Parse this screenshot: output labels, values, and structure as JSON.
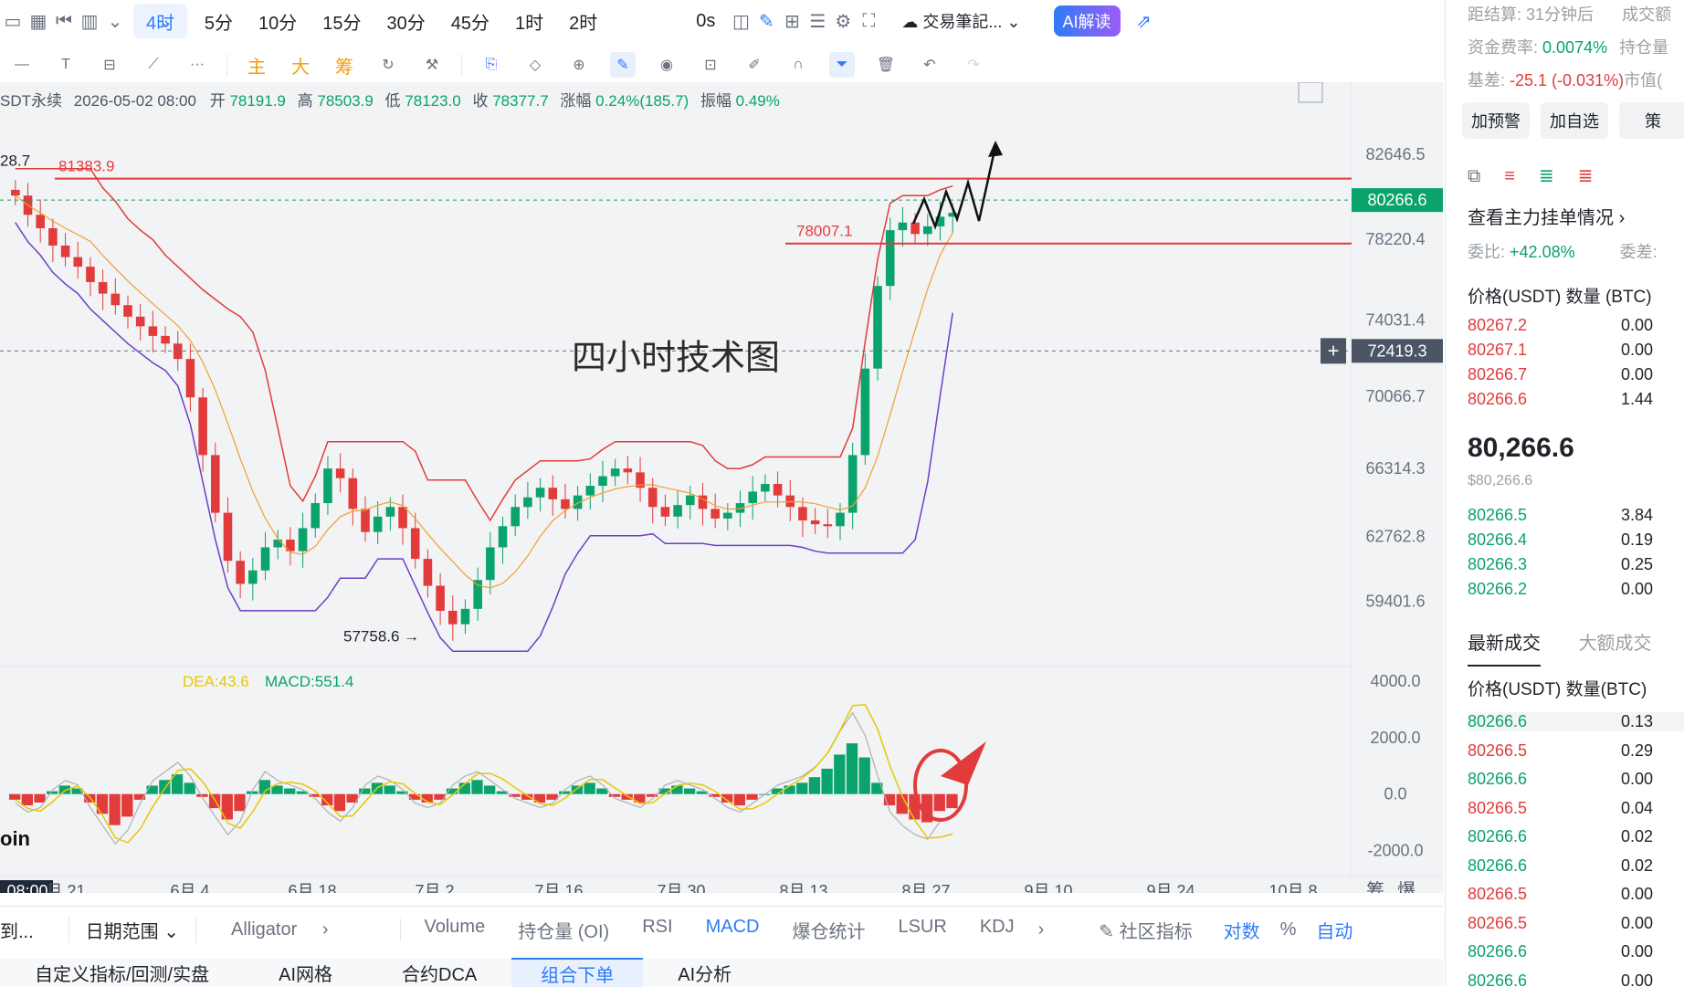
{
  "toolbar": {
    "timeframes": [
      "4时",
      "5分",
      "10分",
      "15分",
      "30分",
      "45分",
      "1时",
      "2时"
    ],
    "active_timeframe": "4时",
    "realtime_label": "0s",
    "journal_label": "交易筆記...",
    "ai_label": "AI解读"
  },
  "drawing_tools": {
    "indicator_labels": [
      "主",
      "大",
      "筹"
    ]
  },
  "ohlc": {
    "symbol": "SDT永续",
    "datetime": "2026-05-02 08:00",
    "open_label": "开",
    "open": "78191.9",
    "high_label": "高",
    "high": "78503.9",
    "low_label": "低",
    "low": "78123.0",
    "close_label": "收",
    "close": "78377.7",
    "change_label": "涨幅",
    "change": "0.24%(185.7)",
    "amplitude_label": "振幅",
    "amplitude": "0.49%"
  },
  "chart_data": {
    "type": "candlestick",
    "annotation_title": "四小时技术图",
    "price_axis_ticks": [
      "82646.5",
      "78220.4",
      "74031.4",
      "70066.7",
      "66314.3",
      "62762.8",
      "59401.6"
    ],
    "current_price_tag": "80266.6",
    "crosshair_price_tag": "72419.3",
    "hline_labels": [
      "81383.9",
      "78007.1"
    ],
    "high_marker": "28.7",
    "low_marker": "57758.6 →",
    "time_axis_ticks": [
      "08:00",
      "月 21",
      "6月 4",
      "6月 18",
      "7月 2",
      "7月 16",
      "7月 30",
      "8月 13",
      "8月 27",
      "9月 10",
      "9月 24",
      "10月 8"
    ],
    "close_series": [
      80500,
      79500,
      78800,
      77900,
      77300,
      76800,
      76000,
      75400,
      74800,
      74200,
      73700,
      73200,
      72800,
      72000,
      70000,
      67000,
      64000,
      61500,
      60300,
      61000,
      62200,
      62600,
      62000,
      63200,
      64500,
      66300,
      65800,
      64200,
      63000,
      63800,
      64300,
      63200,
      61600,
      60200,
      58900,
      58200,
      59000,
      60500,
      62200,
      63300,
      64300,
      64800,
      65300,
      64700,
      64200,
      64900,
      65400,
      65900,
      66300,
      66100,
      65300,
      64300,
      63800,
      64400,
      64900,
      64200,
      63700,
      64000,
      64500,
      65100,
      65500,
      64900,
      64300,
      63600,
      63400,
      63300,
      64000,
      67000,
      71500,
      75800,
      78700,
      79100,
      78500,
      78900,
      79400,
      79600
    ],
    "macd": {
      "dea_label": "DEA:43.6",
      "macd_label": "MACD:551.4",
      "axis_ticks": [
        "4000.0",
        "2000.0",
        "0.0",
        "-2000.0"
      ],
      "histogram": [
        -200,
        -400,
        -300,
        100,
        300,
        200,
        -300,
        -700,
        -1100,
        -800,
        -200,
        300,
        500,
        700,
        400,
        -100,
        -500,
        -900,
        -600,
        100,
        500,
        300,
        200,
        100,
        -100,
        -400,
        -600,
        -300,
        200,
        400,
        300,
        100,
        -200,
        -300,
        -200,
        200,
        400,
        500,
        300,
        100,
        -100,
        -200,
        -300,
        -200,
        100,
        300,
        400,
        200,
        -100,
        -200,
        -300,
        -100,
        200,
        300,
        200,
        100,
        -100,
        -300,
        -400,
        -200,
        0,
        200,
        300,
        400,
        600,
        900,
        1400,
        1800,
        1300,
        400,
        -400,
        -700,
        -900,
        -1000,
        -600,
        -500
      ]
    }
  },
  "chart_controls": {
    "chip_label": "筹",
    "burst_label": "爆",
    "coin_label": "oin"
  },
  "indicator_bar": {
    "left_labels": [
      "到...",
      "日期范围",
      "Alligator"
    ],
    "tabs": [
      "Volume",
      "持仓量 (OI)",
      "RSI",
      "MACD",
      "爆仓统计",
      "LSUR",
      "KDJ"
    ],
    "active_tab": "MACD",
    "community": "社区指标",
    "log": "对数",
    "percent": "%",
    "auto": "自动"
  },
  "bottom_tabs": [
    "自定义指标/回测/实盘",
    "AI网格",
    "合约DCA",
    "组合下单",
    "AI分析"
  ],
  "bottom_active": "组合下单",
  "right_panel": {
    "settle_label": "距结算:",
    "settle_value": "31分钟后",
    "volume_label": "成交额",
    "funding_label": "资金费率:",
    "funding_value": "0.0074%",
    "oi_label": "持仓量",
    "basis_label": "基差:",
    "basis_value": "-25.1 (-0.031%)",
    "mkt_label": "市值(",
    "btn_alert": "加预警",
    "btn_fav": "加自选",
    "btn_strategy": "策",
    "orderbook_title": "查看主力挂单情况",
    "ratio_label": "委比:",
    "ratio_value": "+42.08%",
    "diff_label": "委差:",
    "col_price": "价格(USDT)",
    "col_qty": "数量 (BTC)",
    "asks": [
      {
        "price": "80267.2",
        "qty": "0.00"
      },
      {
        "price": "80267.1",
        "qty": "0.00"
      },
      {
        "price": "80266.7",
        "qty": "0.00"
      },
      {
        "price": "80266.6",
        "qty": "1.44"
      }
    ],
    "last_price": "80,266.6",
    "last_price_usd": "$80,266.6",
    "bids": [
      {
        "price": "80266.5",
        "qty": "3.84"
      },
      {
        "price": "80266.4",
        "qty": "0.19"
      },
      {
        "price": "80266.3",
        "qty": "0.25"
      },
      {
        "price": "80266.2",
        "qty": "0.00"
      }
    ],
    "trades_tab": "最新成交",
    "big_trades_tab": "大额成交",
    "trade_col_price": "价格(USDT)",
    "trade_col_qty": "数量(BTC)",
    "trades": [
      {
        "price": "80266.6",
        "qty": "0.13",
        "side": "buy"
      },
      {
        "price": "80266.5",
        "qty": "0.29",
        "side": "sell"
      },
      {
        "price": "80266.6",
        "qty": "0.00",
        "side": "buy"
      },
      {
        "price": "80266.5",
        "qty": "0.04",
        "side": "sell"
      },
      {
        "price": "80266.6",
        "qty": "0.02",
        "side": "buy"
      },
      {
        "price": "80266.6",
        "qty": "0.02",
        "side": "buy"
      },
      {
        "price": "80266.5",
        "qty": "0.00",
        "side": "sell"
      },
      {
        "price": "80266.5",
        "qty": "0.00",
        "side": "sell"
      },
      {
        "price": "80266.6",
        "qty": "0.00",
        "side": "buy"
      },
      {
        "price": "80266.6",
        "qty": "0.00",
        "side": "buy"
      }
    ]
  },
  "colors": {
    "up": "#0aa36b",
    "down": "#e23b3b",
    "accent": "#2e7cf6"
  }
}
